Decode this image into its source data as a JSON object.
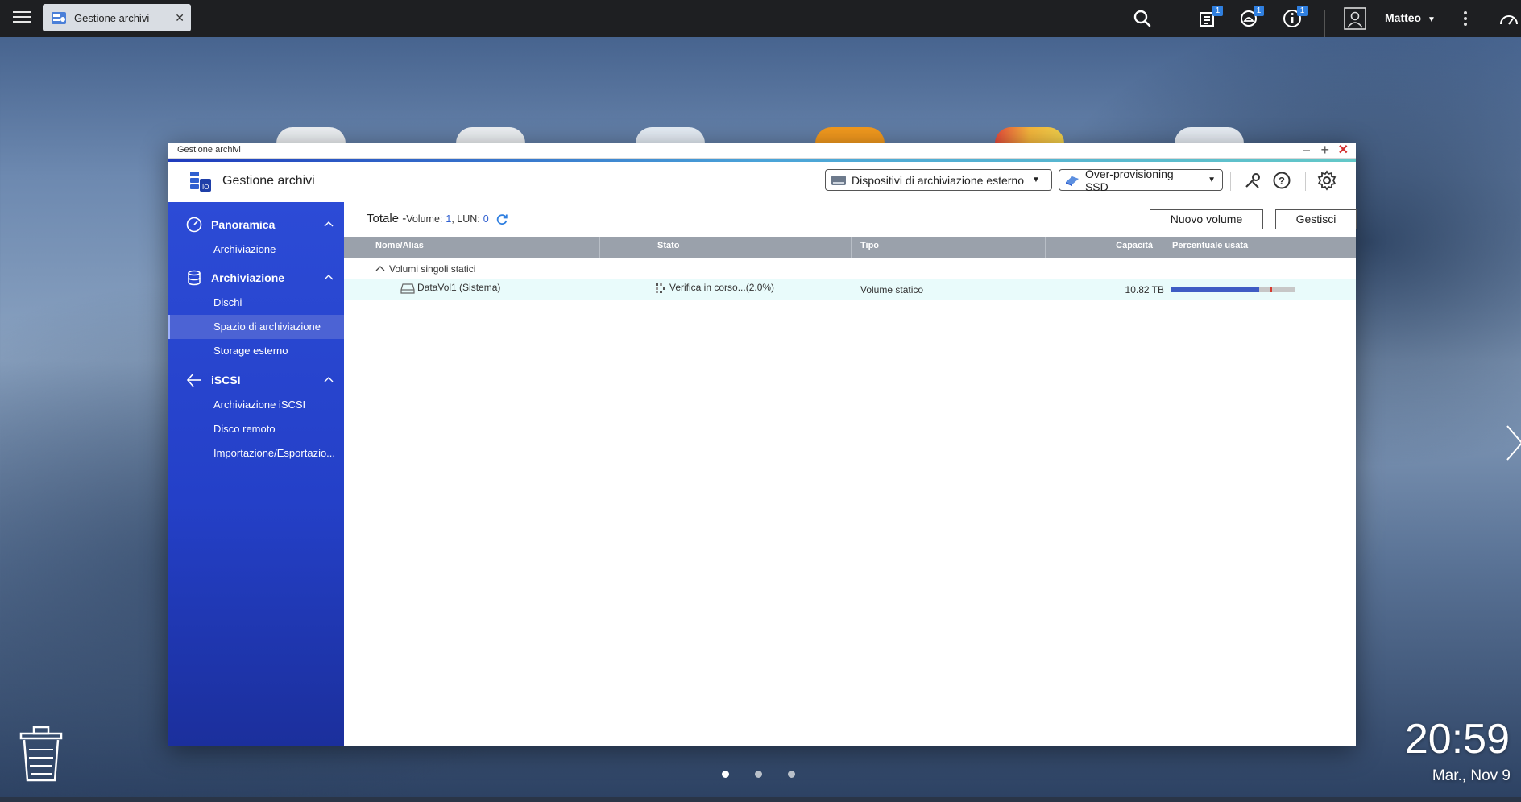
{
  "topbar": {
    "task_tab_label": "Gestione archivi",
    "user_name": "Matteo",
    "badges": {
      "tasks": "1",
      "events": "1",
      "notifications": "1"
    }
  },
  "window": {
    "title": "Gestione archivi",
    "app_title": "Gestione archivi",
    "external_devices_label": "Dispositivi di archiviazione esterno",
    "overprovisioning_label": "Over-provisioning SSD"
  },
  "sidebar": {
    "groups": [
      {
        "label": "Panoramica",
        "items": [
          "Archiviazione"
        ]
      },
      {
        "label": "Archiviazione",
        "items": [
          "Dischi",
          "Spazio di archiviazione",
          "Storage esterno"
        ]
      },
      {
        "label": "iSCSI",
        "items": [
          "Archiviazione iSCSI",
          "Disco remoto",
          "Importazione/Esportazio..."
        ]
      }
    ],
    "active_item": "Spazio di archiviazione"
  },
  "summary": {
    "title": "Totale -",
    "volume_label": "Volume:",
    "volume_count": "1",
    "lun_label": ", LUN:",
    "lun_count": "0"
  },
  "actions": {
    "new_volume": "Nuovo volume",
    "manage": "Gestisci"
  },
  "table": {
    "columns": [
      "Nome/Alias",
      "Stato",
      "Tipo",
      "Capacità",
      "Percentuale usata"
    ],
    "group_label": "Volumi singoli statici",
    "rows": [
      {
        "name": "DataVol1 (Sistema)",
        "status": "Verifica in corso...(2.0%)",
        "type": "Volume statico",
        "capacity": "10.82 TB",
        "used_fraction": 0.71
      }
    ]
  },
  "desktop": {
    "time": "20:59",
    "date": "Mar., Nov 9",
    "page_dots": 3,
    "active_page": 0
  },
  "colors": {
    "sidebar": "#2440c8",
    "accent": "#2f5fd0",
    "table_header": "#9aa1ab",
    "selected_row": "#e9fbfb",
    "usage_fill": "#3f5cc4",
    "close": "#d32f2f"
  }
}
